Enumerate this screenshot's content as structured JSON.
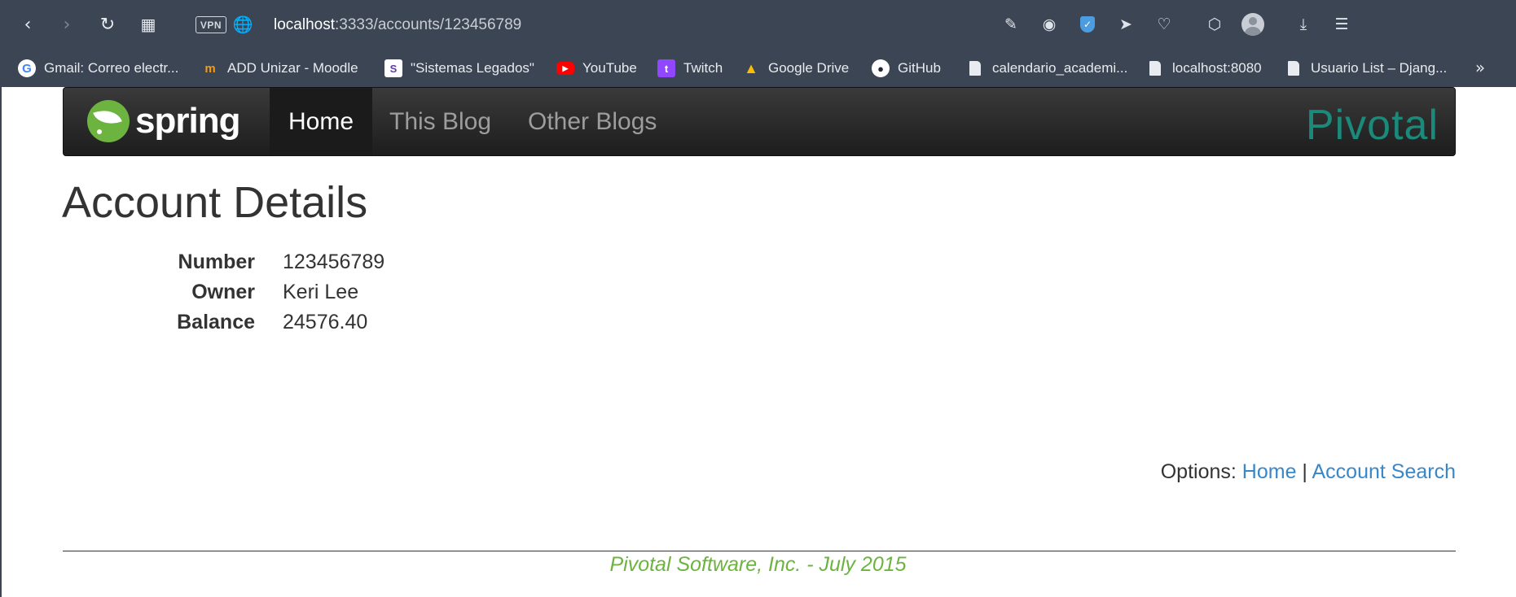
{
  "browser": {
    "url_host": "localhost",
    "url_rest": ":3333/accounts/123456789",
    "vpn_label": "VPN",
    "bookmarks": [
      {
        "label": "Gmail: Correo electr...",
        "icon": "google-icon"
      },
      {
        "label": "ADD Unizar - Moodle",
        "icon": "moodle-icon"
      },
      {
        "label": "\"Sistemas Legados\"",
        "icon": "sistemas-icon"
      },
      {
        "label": "YouTube",
        "icon": "youtube-icon"
      },
      {
        "label": "Twitch",
        "icon": "twitch-icon"
      },
      {
        "label": "Google Drive",
        "icon": "google-drive-icon"
      },
      {
        "label": "GitHub",
        "icon": "github-icon"
      },
      {
        "label": "calendario_academi...",
        "icon": "document-icon"
      },
      {
        "label": "localhost:8080",
        "icon": "document-icon"
      },
      {
        "label": "Usuario List – Djang...",
        "icon": "document-icon"
      }
    ]
  },
  "navbar": {
    "brand": "spring",
    "items": [
      {
        "label": "Home",
        "active": true
      },
      {
        "label": "This Blog",
        "active": false
      },
      {
        "label": "Other Blogs",
        "active": false
      }
    ],
    "partner_logo": "Pivotal"
  },
  "main": {
    "title": "Account Details",
    "fields": [
      {
        "label": "Number",
        "value": "123456789"
      },
      {
        "label": "Owner",
        "value": "Keri Lee"
      },
      {
        "label": "Balance",
        "value": "24576.40"
      }
    ],
    "options_label": "Options:",
    "options_links": [
      "Home",
      "Account Search"
    ],
    "options_sep": "|"
  },
  "footer": {
    "text": "Pivotal Software, Inc. - July 2015"
  },
  "colors": {
    "chrome": "#3b4554",
    "spring_green": "#6db33f",
    "link_blue": "#3a87c8",
    "pivotal_teal": "#1b8a7a"
  }
}
